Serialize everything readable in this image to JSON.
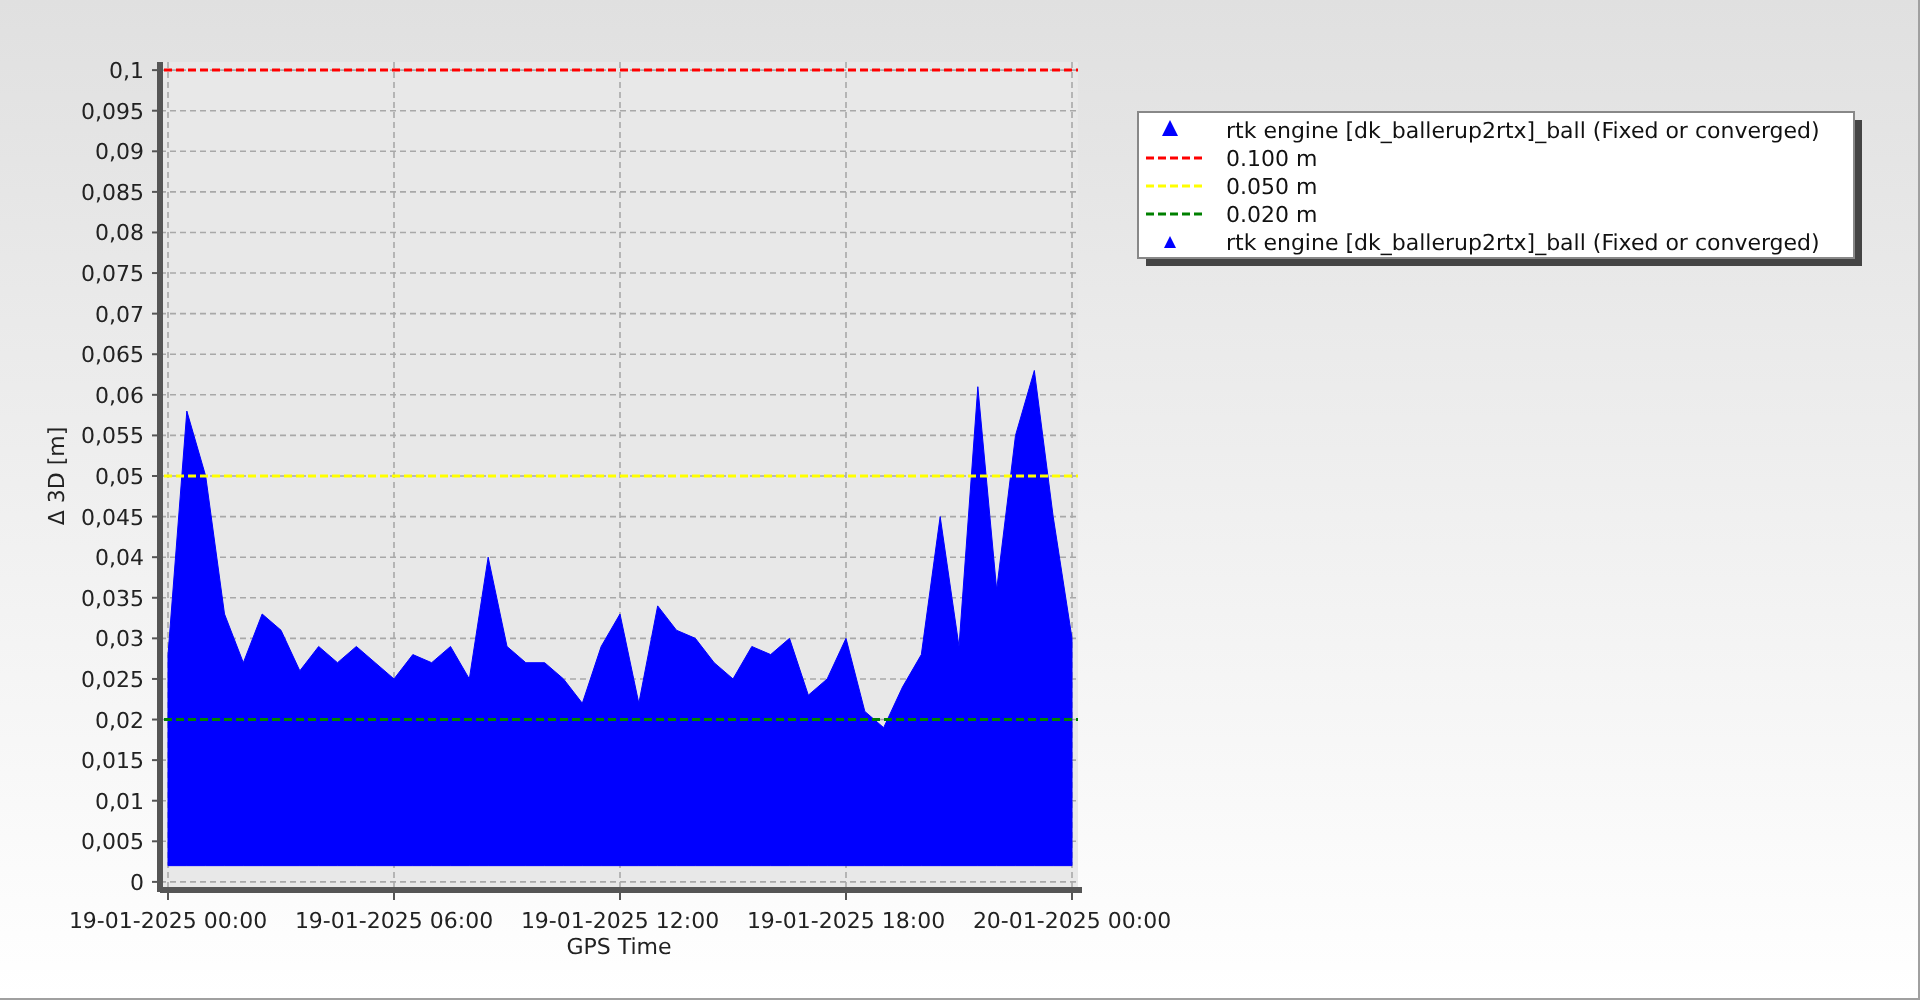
{
  "chart": {
    "chart_data": {
      "type": "area",
      "ylabel": "Δ 3D [m]",
      "xlabel": "GPS Time",
      "grid": true,
      "legend": "upper right",
      "ylim": [
        -0.001,
        0.101
      ],
      "yticks": [
        {
          "value": 0,
          "label": "0"
        },
        {
          "value": 0.005,
          "label": "0,005"
        },
        {
          "value": 0.01,
          "label": "0,01"
        },
        {
          "value": 0.015,
          "label": "0,015"
        },
        {
          "value": 0.02,
          "label": "0,02"
        },
        {
          "value": 0.025,
          "label": "0,025"
        },
        {
          "value": 0.03,
          "label": "0,03"
        },
        {
          "value": 0.035,
          "label": "0,035"
        },
        {
          "value": 0.04,
          "label": "0,04"
        },
        {
          "value": 0.045,
          "label": "0,045"
        },
        {
          "value": 0.05,
          "label": "0,05"
        },
        {
          "value": 0.055,
          "label": "0,055"
        },
        {
          "value": 0.06,
          "label": "0,06"
        },
        {
          "value": 0.065,
          "label": "0,065"
        },
        {
          "value": 0.07,
          "label": "0,07"
        },
        {
          "value": 0.075,
          "label": "0,075"
        },
        {
          "value": 0.08,
          "label": "0,08"
        },
        {
          "value": 0.085,
          "label": "0,085"
        },
        {
          "value": 0.09,
          "label": "0,09"
        },
        {
          "value": 0.095,
          "label": "0,095"
        },
        {
          "value": 0.1,
          "label": "0,1"
        }
      ],
      "categories": [
        "19-01-2025 00:00",
        null,
        null,
        null,
        null,
        null,
        null,
        null,
        null,
        null,
        null,
        null,
        "19-01-2025 06:00",
        null,
        null,
        null,
        null,
        null,
        null,
        null,
        null,
        null,
        null,
        null,
        "19-01-2025 12:00",
        null,
        null,
        null,
        null,
        null,
        null,
        null,
        null,
        null,
        null,
        null,
        "19-01-2025 18:00",
        null,
        null,
        null,
        null,
        null,
        null,
        null,
        null,
        null,
        null,
        null,
        "20-01-2025 00:00"
      ],
      "series": [
        {
          "name": "rtk engine [dk_ballerup2rtx]_ball (Fixed or converged)",
          "color": "#0000ff",
          "values": [
            0.028,
            0.058,
            0.05,
            0.033,
            0.027,
            0.033,
            0.031,
            0.026,
            0.029,
            0.027,
            0.029,
            0.027,
            0.025,
            0.028,
            0.027,
            0.029,
            0.025,
            0.04,
            0.029,
            0.027,
            0.027,
            0.025,
            0.022,
            0.029,
            0.033,
            0.022,
            0.034,
            0.031,
            0.03,
            0.027,
            0.025,
            0.029,
            0.028,
            0.03,
            0.023,
            0.025,
            0.03,
            0.021,
            0.019,
            0.024,
            0.028,
            0.045,
            0.029,
            0.061,
            0.036,
            0.055,
            0.063,
            0.045,
            0.03
          ]
        }
      ],
      "ref_lines": [
        {
          "axis": "y",
          "value": 0.1,
          "label": "0.100 m",
          "color": "#ff0000"
        },
        {
          "axis": "y",
          "value": 0.05,
          "label": "0.050 m",
          "color": "#ffff00"
        },
        {
          "axis": "y",
          "value": 0.02,
          "label": "0.020 m",
          "color": "#008000"
        }
      ]
    },
    "legend_extra": {
      "label": "rtk engine [dk_ballerup2rtx]_ball (Fixed or converged)"
    }
  }
}
